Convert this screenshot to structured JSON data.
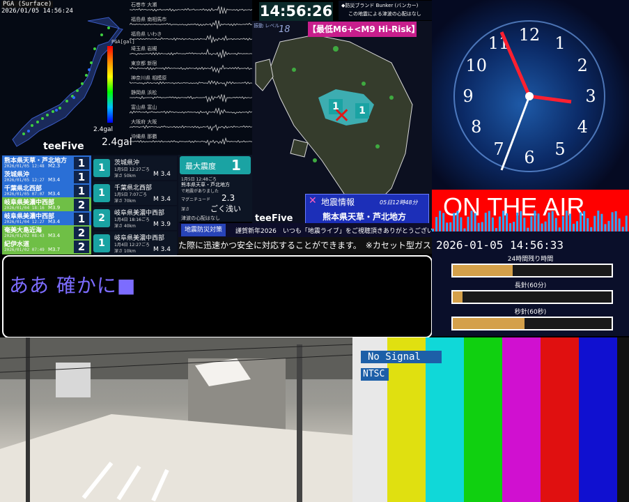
{
  "seismic": {
    "title": "PGA (Surface)",
    "timestamp": "2026/01/05 14:56:24",
    "gal_small": "2.4gal",
    "gal_big": "2.4gal",
    "scale_label": "PGA[gal]",
    "brand": "teeFive",
    "wave_labels": [
      "石巻市 大瀬",
      "福島県 南相馬市",
      "福島県 いわき",
      "埼玉県 岩槻",
      "東京都 新宿",
      "神奈川県 相模原",
      "静岡県 浜松",
      "富山県 富山",
      "大阪府 大阪",
      "沖縄県 那覇"
    ]
  },
  "quake_list": [
    {
      "name": "熊本県天草・芦北地方",
      "date": "2026/01/05 12:48",
      "mag": "M2.3",
      "shindo": "1",
      "bg": "#2a6fd6"
    },
    {
      "name": "茨城県沖",
      "date": "2026/01/05 12:27",
      "mag": "M3.4",
      "shindo": "1",
      "bg": "#2a6fd6"
    },
    {
      "name": "千葉県北西部",
      "date": "2026/01/05 07:07",
      "mag": "M3.4",
      "shindo": "1",
      "bg": "#2a6fd6"
    },
    {
      "name": "岐阜県美濃中西部",
      "date": "2026/01/04 18:16",
      "mag": "M3.9",
      "shindo": "2",
      "bg": "#6fbf46"
    },
    {
      "name": "岐阜県美濃中西部",
      "date": "2026/01/04 12:27",
      "mag": "M3.4",
      "shindo": "1",
      "bg": "#2a6fd6"
    },
    {
      "name": "奄美大島近海",
      "date": "2026/01/02 08:43",
      "mag": "M3.4",
      "shindo": "2",
      "bg": "#6fbf46"
    },
    {
      "name": "紀伊水道",
      "date": "2026/01/02 07:49",
      "mag": "M3.7",
      "shindo": "2",
      "bg": "#6fbf46"
    }
  ],
  "quake_cards": [
    {
      "shindo": "1",
      "region": "茨城県沖",
      "time": "1月5日 12:27ごろ",
      "depth": "深さ 50km",
      "mag": "M 3.4"
    },
    {
      "shindo": "1",
      "region": "千葉県北西部",
      "time": "1月5日 7:07ごろ",
      "depth": "深さ 70km",
      "mag": "M 3.4"
    },
    {
      "shindo": "2",
      "region": "岐阜県美濃中西部",
      "time": "1月4日 18:16ごろ",
      "depth": "深さ 40km",
      "mag": "M 3.9"
    },
    {
      "shindo": "1",
      "region": "岐阜県美濃中西部",
      "time": "1月4日 12:27ごろ",
      "depth": "深さ 10km",
      "mag": "M 3.4"
    }
  ],
  "info_card": {
    "max_label": "最大震度",
    "max_value": "1",
    "time": "1月5日 12:48ごろ",
    "region": "熊本県天草・芦北地方",
    "note": "で地震がありました",
    "mag_label": "マグニチュード",
    "mag_value": "2.3",
    "depth_label": "深さ",
    "depth_value": "ごく浅い",
    "tsunami": "津波の心配はなし"
  },
  "kyushu": {
    "clock": "14:56:26",
    "level_label": "振動 レベル",
    "level": "18",
    "risk": "【最低M6+<M9 Hi-Risk】",
    "bunker_title": "◆防災ブランド Bunker (バンカー)",
    "bunker_note": "この地震による津波の心配はなし",
    "marker_value_1": "1",
    "marker_value_2": "1",
    "info_title": "地震情報",
    "info_time": "05日12時48分",
    "info_region": "熊本県天草・芦北地方",
    "brand": "teeFive"
  },
  "ticker": {
    "tag": "地震防災対策",
    "headline": "謹賀新年2026　いつも「地震ライブ」をご視聴頂きありがとうございます!",
    "scroll": "た際に迅速かつ安全に対応することができます。　※カセット型ガスコ"
  },
  "input": {
    "text": "ああ 確かに■"
  },
  "clock": {
    "numbers": [
      "12",
      "1",
      "2",
      "3",
      "4",
      "5",
      "6",
      "7",
      "8",
      "9",
      "10",
      "11"
    ],
    "on_air": "ON THE AIR",
    "datetime": "2026-01-05 14:56:33",
    "label_24h": "24時間残り時間",
    "label_min": "長針(60分)",
    "label_sec": "秒針(60秒)",
    "progress_24h": 0.378,
    "progress_min": 0.06,
    "progress_sec": 0.45
  },
  "test_pattern": {
    "no_signal": "No Signal",
    "ntsc": "NTSC",
    "colors": [
      "#e8e8e8",
      "#e0e010",
      "#10d8d8",
      "#10d010",
      "#d010d0",
      "#e01010",
      "#1010d0",
      "#111111"
    ]
  }
}
